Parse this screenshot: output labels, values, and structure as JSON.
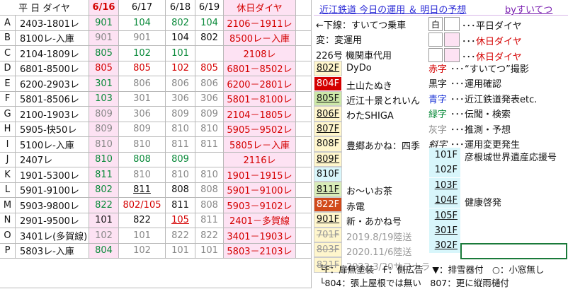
{
  "header": {
    "col_label": "平 日 ダイヤ",
    "dates": [
      "6/16",
      "6/17",
      "6/18",
      "6/19"
    ],
    "holiday_label": "休日ダイヤ",
    "site_title": "近江鉄道 今日の運用 ＆ 明日の予想",
    "byline": "byすいてつ"
  },
  "rows": [
    {
      "letter": "A",
      "train": "2403-1801レ",
      "d1": "901",
      "d2": "104",
      "d3": "802",
      "d4": "104",
      "hol": "2106－1911レ"
    },
    {
      "letter": "B",
      "train": "8100レ-入庫",
      "d1": "901",
      "d2": "901",
      "d3": "104",
      "d4": "802",
      "hol": "8500レ－入庫"
    },
    {
      "letter": "C",
      "train": "2104-1809レ",
      "d1": "805",
      "d2": "102",
      "d3": "101",
      "d4": "",
      "hol": "2108レ"
    },
    {
      "letter": "D",
      "train": "6801-8500レ",
      "d1": "805",
      "d2": "805",
      "d3": "102",
      "d4": "805",
      "hol": "6801－8502レ"
    },
    {
      "letter": "E",
      "train": "6200-2903レ",
      "d1": "301",
      "d2": "806",
      "d3": "806",
      "d4": "806",
      "hol": "6200－2801レ"
    },
    {
      "letter": "F",
      "train": "5801-8506レ",
      "d1": "103",
      "d2": "301",
      "d3": "306",
      "d4": "306",
      "hol": "5801－8100レ"
    },
    {
      "letter": "G",
      "train": "2100-1903レ",
      "d1": "809",
      "d2": "306",
      "d3": "809",
      "d4": "809",
      "hol": "2104－1805レ"
    },
    {
      "letter": "H",
      "train": "5905-快50レ",
      "d1": "809",
      "d2": "809",
      "d3": "810",
      "d4": "810",
      "hol": "5905－9502レ"
    },
    {
      "letter": "I",
      "train": "5100レ-入庫",
      "d1": "810",
      "d2": "810",
      "d3": "811",
      "d4": "811",
      "hol": "5805レ－入庫"
    },
    {
      "letter": "J",
      "train": "2407レ",
      "d1": "810",
      "d2": "808",
      "d3": "809",
      "d4": "",
      "hol": "2116レ"
    },
    {
      "letter": "K",
      "train": "1901-5300レ",
      "d1": "811",
      "d2": "810",
      "d3": "810",
      "d4": "810",
      "hol": "1901－1915レ"
    },
    {
      "letter": "L",
      "train": "5901-9100レ",
      "d1": "802",
      "d2": "811",
      "d3": "808",
      "d4": "808",
      "hol": "5901－9100レ"
    },
    {
      "letter": "M",
      "train": "5903-9800レ",
      "d1": "822",
      "d2": "802/105",
      "d3": "811",
      "d4": "808",
      "hol": "5903－9102レ"
    },
    {
      "letter": "N",
      "train": "2901-9500レ",
      "d1": "101",
      "d2": "822",
      "d3": "105",
      "d4": "811",
      "hol": "2401－多賀線"
    },
    {
      "letter": "O",
      "train": "3401レ(多賀線)",
      "d1": "102",
      "d2": "101",
      "d3": "822",
      "d4": "822",
      "hol": "3401－1903レ"
    },
    {
      "letter": "P",
      "train": "5803レ-入庫",
      "d1": "804",
      "d2": "102",
      "d3": "101",
      "d4": "101",
      "hol": "5803－2103レ"
    }
  ],
  "cars": [
    {
      "label": "←下線：すいてつ乗車"
    },
    {
      "label": "変：変運用"
    },
    {
      "label": "226号 機関車代用"
    },
    {
      "num": "802F",
      "name": "DyDo"
    },
    {
      "num": "804F",
      "name": "土山たぬき"
    },
    {
      "num": "805F",
      "name": "近江十景とれいん"
    },
    {
      "num": "806F",
      "name": "わたSHIGA"
    },
    {
      "num": "807F",
      "name": ""
    },
    {
      "num": "808F",
      "name": "豊郷あかね：四季"
    },
    {
      "num": "809F",
      "name": ""
    },
    {
      "num": "810F",
      "name": ""
    },
    {
      "num": "811F",
      "name": "お～いお茶"
    },
    {
      "num": "822F",
      "name": "赤電"
    },
    {
      "num": "901F",
      "name": "新・あかね号"
    },
    {
      "num": "701F",
      "name": "2019.8/19陸送"
    },
    {
      "num": "803F",
      "name": "2020.11/6陸送"
    },
    {
      "num": "821F",
      "name": "2022.3/20サヨナラ"
    }
  ],
  "legend": {
    "shiro": "白",
    "heijitsu": "平日ダイヤ",
    "kyujitsu": "休日ダイヤ",
    "dots": "･･･"
  },
  "colorkey": [
    {
      "k": "赤字",
      "v": "“すいてつ”撮影"
    },
    {
      "k": "黒字",
      "v": "運用確認"
    },
    {
      "k": "青字",
      "v": "近江鉄道発表etc."
    },
    {
      "k": "緑字",
      "v": "伝聞・検索"
    },
    {
      "k": "灰字",
      "v": "推測・予想"
    },
    {
      "k": "斜字",
      "v": "運用変更発生"
    }
  ],
  "smallcars": [
    {
      "num": "101F",
      "name": "彦根城世界遺産応援号"
    },
    {
      "num": "102F",
      "name": ""
    },
    {
      "num": "103F",
      "name": ""
    },
    {
      "num": "104F",
      "name": "健康啓発"
    },
    {
      "num": "105F",
      "name": ""
    },
    {
      "num": "301F",
      "name": ""
    },
    {
      "num": "302F",
      "name": ""
    }
  ],
  "notes": {
    "line1": "└F：扉無塗装　F：側広告　▼：排雪器付　○：小窓無し",
    "line2": "└804：張上屋根では無い　807：更に縦雨樋付"
  },
  "colors": {
    "red": "#d40000",
    "green": "#0a8a3a",
    "blue": "#1a33d6",
    "pink": "#fde2f3",
    "yellow": "#fff6cc",
    "cyan": "#d8f6fb"
  }
}
